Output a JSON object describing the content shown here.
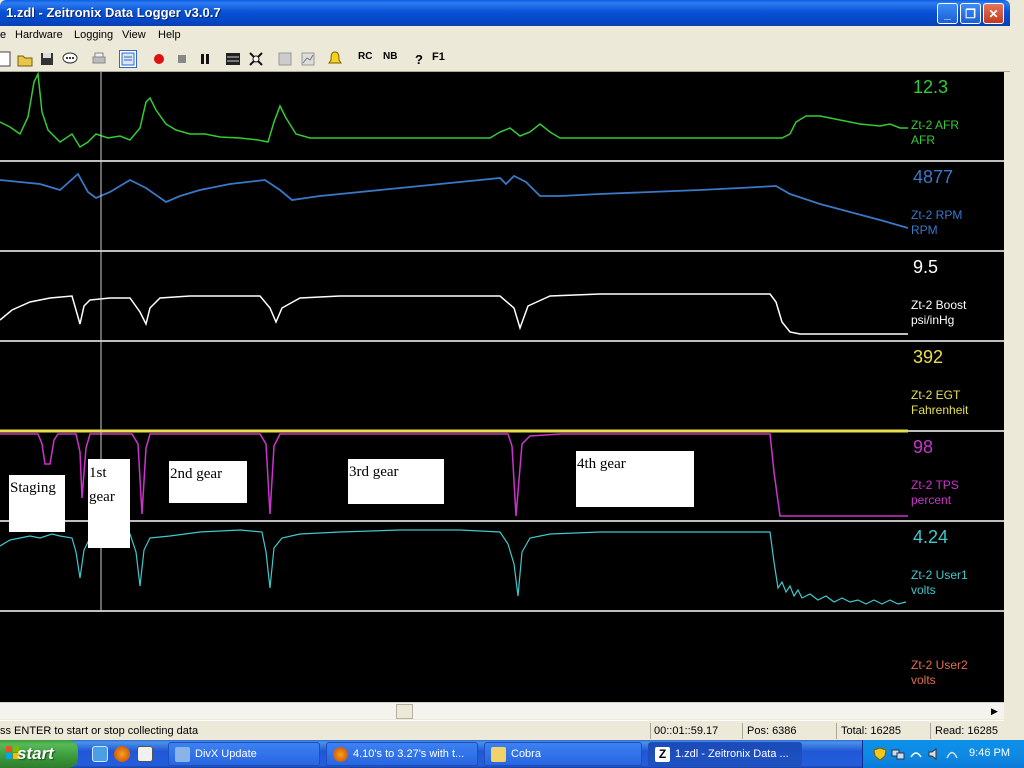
{
  "window": {
    "title": "1.zdl - Zeitronix Data Logger v3.0.7",
    "minimize": "_",
    "maximize": "❐",
    "close": "✕"
  },
  "menu": [
    "e",
    "Hardware",
    "Logging",
    "View",
    "Help"
  ],
  "toolbar": {
    "nb_label": "NB",
    "f1_label": "F1",
    "rc_label": "RC"
  },
  "channels": [
    {
      "value": "12.3",
      "name": "Zt-2 AFR",
      "unit": "AFR",
      "color": "#33cc33"
    },
    {
      "value": "4877",
      "name": "Zt-2 RPM",
      "unit": "RPM",
      "color": "#3a78c8"
    },
    {
      "value": "9.5",
      "name": "Zt-2 Boost",
      "unit": "psi/inHg",
      "color": "#ffffff"
    },
    {
      "value": "392",
      "name": "Zt-2 EGT",
      "unit": "Fahrenheit",
      "color": "#e6e04a"
    },
    {
      "value": "98",
      "name": "Zt-2 TPS",
      "unit": "percent",
      "color": "#cc33cc"
    },
    {
      "value": "4.24",
      "name": "Zt-2 User1",
      "unit": "volts",
      "color": "#40c8cc"
    },
    {
      "value": "",
      "name": "Zt-2 User2",
      "unit": "volts",
      "color": "#e07050"
    }
  ],
  "annotations": {
    "staging": "Staging",
    "first_line1": "1st",
    "first_line2": "gear",
    "second": "2nd gear",
    "third": "3rd gear",
    "fourth": "4th gear"
  },
  "status": {
    "hint": "ss ENTER to start or stop collecting data",
    "time": "00::01::59.17",
    "pos": "Pos: 6386",
    "total": "Total: 16285",
    "read": "Read: 16285"
  },
  "taskbar": {
    "start": "start",
    "tasks": [
      "DivX Update",
      "4.10's to 3.27's with t...",
      "Cobra",
      "1.zdl - Zeitronix Data ..."
    ],
    "clock": "9:46 PM"
  },
  "colors": {
    "plot_bg": "#000000",
    "divider": "#bfbfbf",
    "cursor": "#cfcfcf",
    "xp_blue": "#0853d6"
  }
}
